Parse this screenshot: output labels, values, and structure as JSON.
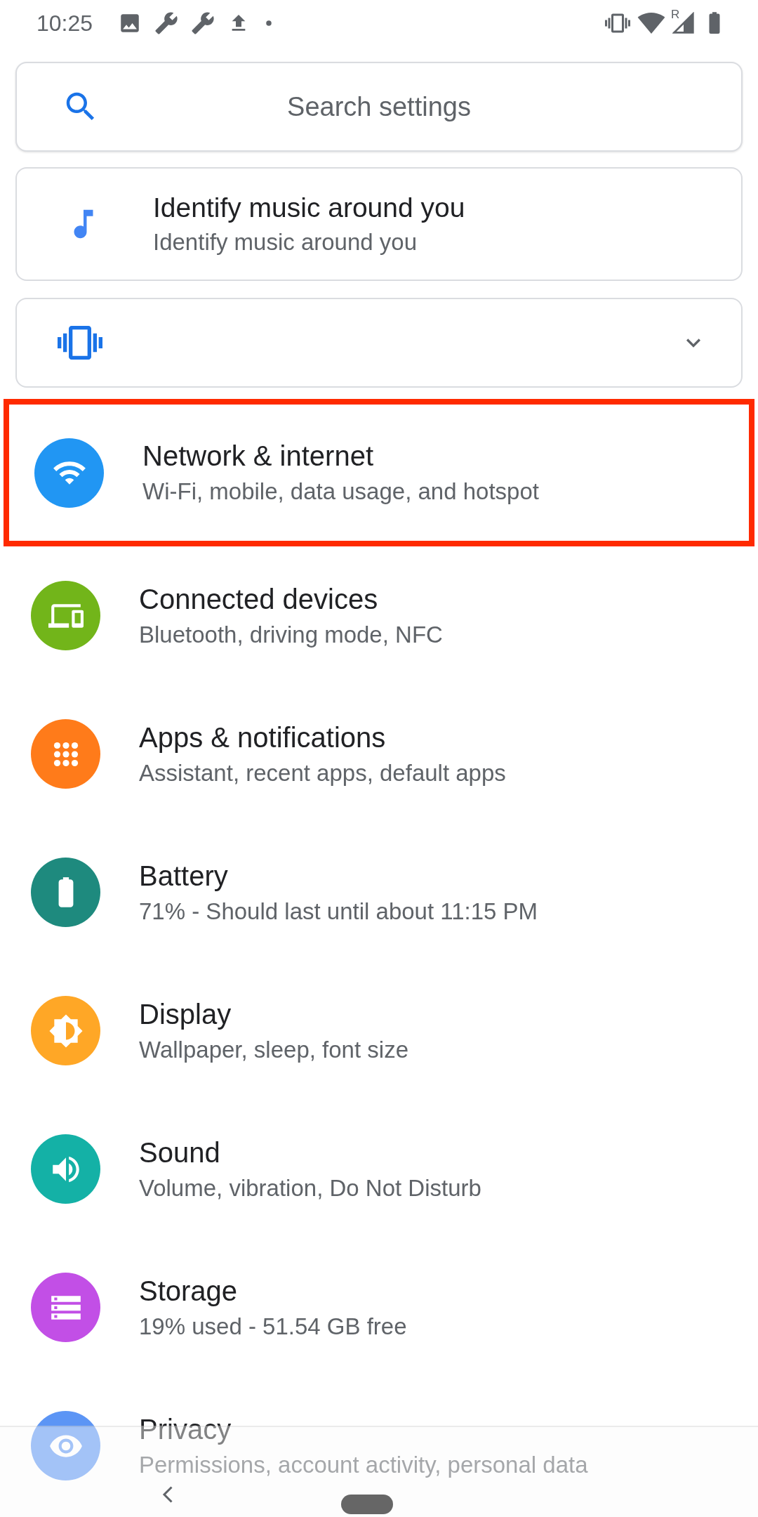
{
  "status_bar": {
    "time": "10:25",
    "roaming_mark": "R"
  },
  "search": {
    "placeholder": "Search settings"
  },
  "suggestion": {
    "title": "Identify music around you",
    "subtitle": "Identify music around you"
  },
  "collapsed_card": {
    "expanded": false
  },
  "items": [
    {
      "kind": "wifi",
      "title": "Network & internet",
      "subtitle": "Wi-Fi, mobile, data usage, and hotspot",
      "color": "#2196f3",
      "highlighted": true
    },
    {
      "kind": "devices",
      "title": "Connected devices",
      "subtitle": "Bluetooth, driving mode, NFC",
      "color": "#72b51a",
      "highlighted": false
    },
    {
      "kind": "apps",
      "title": "Apps & notifications",
      "subtitle": "Assistant, recent apps, default apps",
      "color": "#ff7b1a",
      "highlighted": false
    },
    {
      "kind": "battery",
      "title": "Battery",
      "subtitle": "71% - Should last until about 11:15 PM",
      "color": "#1e8a7e",
      "highlighted": false
    },
    {
      "kind": "display",
      "title": "Display",
      "subtitle": "Wallpaper, sleep, font size",
      "color": "#ffa726",
      "highlighted": false
    },
    {
      "kind": "sound",
      "title": "Sound",
      "subtitle": "Volume, vibration, Do Not Disturb",
      "color": "#14b1a6",
      "highlighted": false
    },
    {
      "kind": "storage",
      "title": "Storage",
      "subtitle": "19% used - 51.54 GB free",
      "color": "#c24fe6",
      "highlighted": false
    },
    {
      "kind": "privacy",
      "title": "Privacy",
      "subtitle": "Permissions, account activity, personal data",
      "color": "#5c95f5",
      "highlighted": false
    }
  ]
}
